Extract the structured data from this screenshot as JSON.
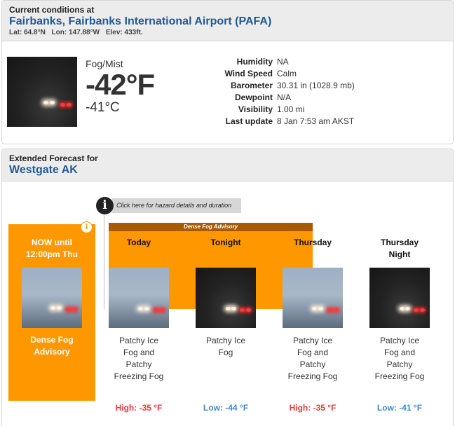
{
  "current": {
    "heading": "Current conditions at",
    "station": "Fairbanks, Fairbanks International Airport (PAFA)",
    "lat": "Lat: 64.8°N",
    "lon": "Lon: 147.88°W",
    "elev": "Elev: 433ft.",
    "summary": "Fog/Mist",
    "temp_f": "-42°F",
    "temp_c": "-41°C",
    "details": [
      {
        "label": "Humidity",
        "value": "NA"
      },
      {
        "label": "Wind Speed",
        "value": "Calm"
      },
      {
        "label": "Barometer",
        "value": "30.31 in (1028.9 mb)"
      },
      {
        "label": "Dewpoint",
        "value": "N/A"
      },
      {
        "label": "Visibility",
        "value": "1.00 mi"
      },
      {
        "label": "Last update",
        "value": "8 Jan 7:53 am AKST"
      }
    ]
  },
  "forecast": {
    "heading": "Extended Forecast for",
    "location": "Westgate AK",
    "hazard_link": "Click here for hazard details and duration",
    "advisory_bar": "Dense Fog Advisory",
    "now": {
      "title_line1": "NOW until",
      "title_line2": "12:00pm Thu",
      "cond_line1": "Dense Fog",
      "cond_line2": "Advisory"
    },
    "periods": [
      {
        "name": "Today",
        "name2": "",
        "cond": [
          "Patchy Ice",
          "Fog and",
          "Patchy",
          "Freezing Fog"
        ],
        "temp": "High: -35 °F",
        "temp_type": "high",
        "image": "fog-light"
      },
      {
        "name": "Tonight",
        "name2": "",
        "cond": [
          "Patchy Ice",
          "Fog",
          "",
          ""
        ],
        "temp": "Low: -44 °F",
        "temp_type": "low",
        "image": "fog-dark"
      },
      {
        "name": "Thursday",
        "name2": "",
        "cond": [
          "Patchy Ice",
          "Fog and",
          "Patchy",
          "Freezing Fog"
        ],
        "temp": "High: -35 °F",
        "temp_type": "high",
        "image": "fog-light"
      },
      {
        "name": "Thursday",
        "name2": "Night",
        "cond": [
          "Patchy Ice",
          "Fog and",
          "Patchy",
          "Freezing Fog"
        ],
        "temp": "Low: -41 °F",
        "temp_type": "low",
        "image": "fog-dark"
      }
    ]
  },
  "colors": {
    "advisory": "#ff9800",
    "advisory_bar": "#a85a00",
    "high_temp": "#e83b3b",
    "low_temp": "#3a8ad8",
    "link_blue": "#1f5a96"
  },
  "icons": {
    "info": "info-circle-icon"
  }
}
